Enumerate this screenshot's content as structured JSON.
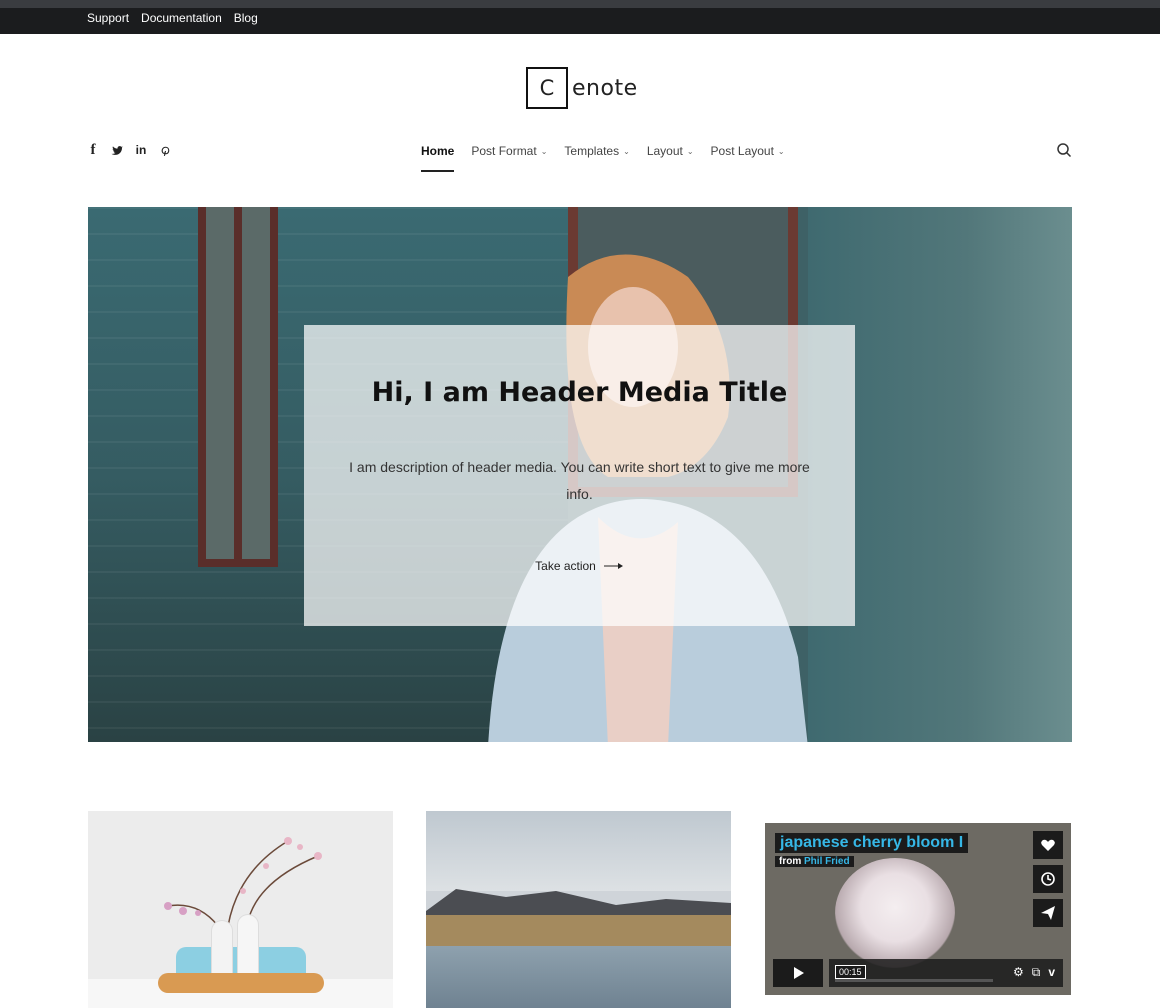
{
  "topbar": {
    "links": [
      "Support",
      "Documentation",
      "Blog"
    ]
  },
  "logo": {
    "box_letter": "C",
    "rest": "enote"
  },
  "social": {
    "icons": [
      "facebook-icon",
      "twitter-icon",
      "linkedin-icon",
      "pinterest-icon"
    ],
    "labels": [
      "f",
      "",
      "in",
      ""
    ]
  },
  "nav": {
    "items": [
      {
        "label": "Home",
        "active": true,
        "dropdown": false
      },
      {
        "label": "Post Format",
        "active": false,
        "dropdown": true
      },
      {
        "label": "Templates",
        "active": false,
        "dropdown": true
      },
      {
        "label": "Layout",
        "active": false,
        "dropdown": true
      },
      {
        "label": "Post Layout",
        "active": false,
        "dropdown": true
      }
    ]
  },
  "hero": {
    "title": "Hi, I am Header Media Title",
    "description": "I am description of header media. You can write short text to give me more info.",
    "cta_label": "Take action"
  },
  "cards": {
    "video": {
      "title": "japanese cherry bloom I",
      "from_label": "from",
      "author": "Phil Fried",
      "time": "00:15"
    }
  },
  "colors": {
    "topbar_bg": "#1b1c1e",
    "video_title": "#36b7e6"
  }
}
